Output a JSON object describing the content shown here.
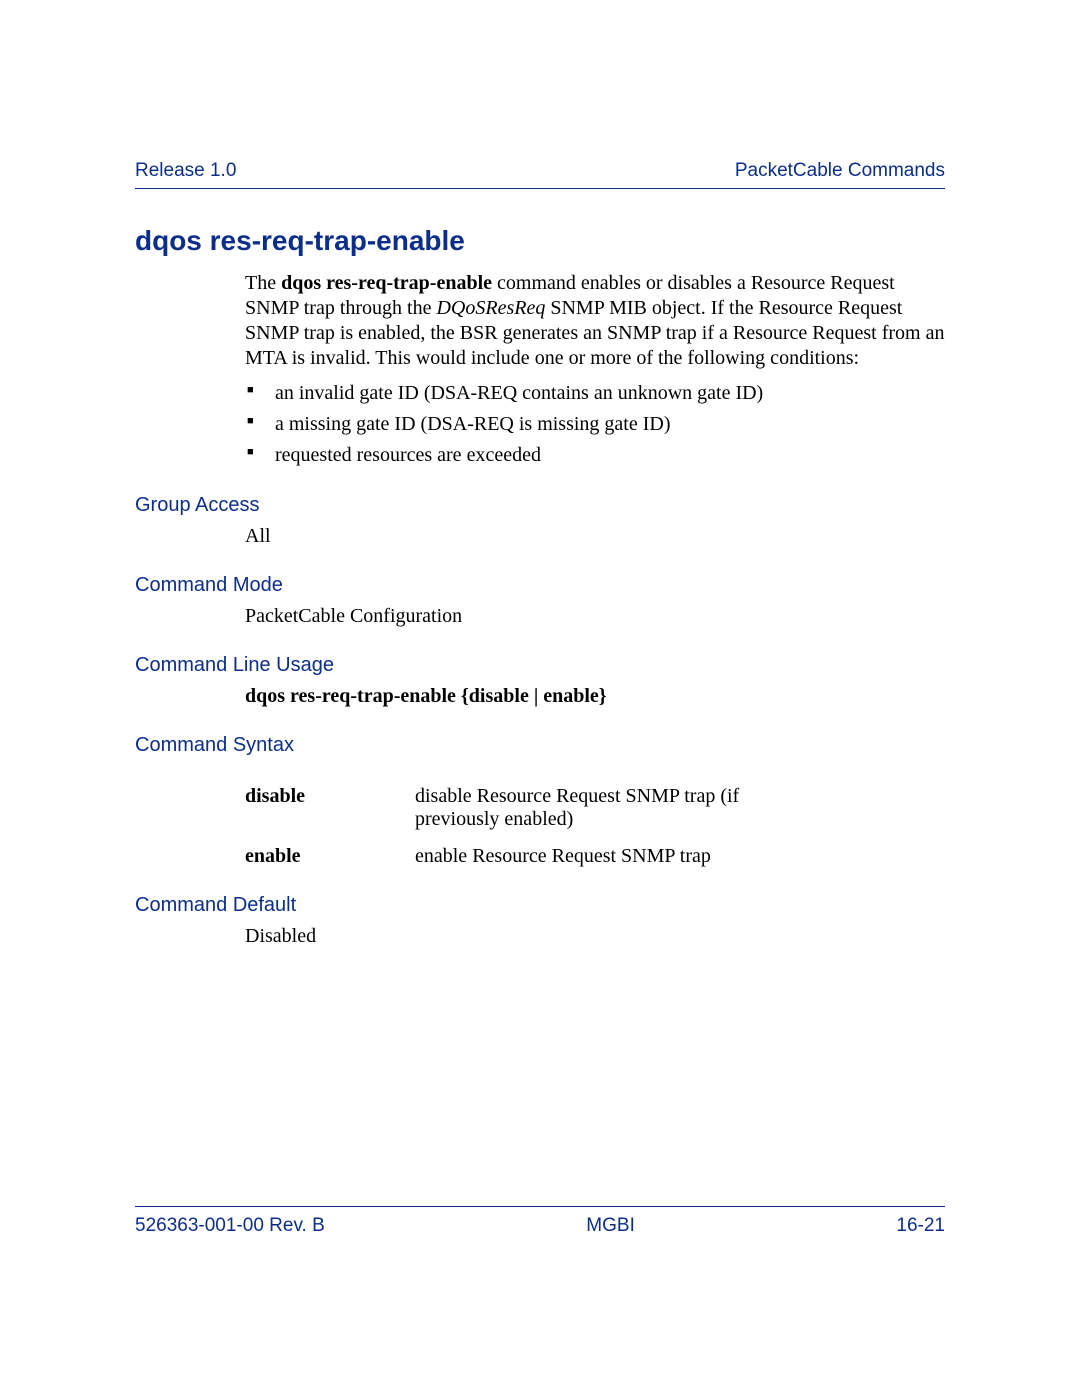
{
  "header": {
    "left": "Release 1.0",
    "right": "PacketCable Commands"
  },
  "title": "dqos res-req-trap-enable",
  "intro": {
    "prefix": "The ",
    "cmd": "dqos res-req-trap-enable",
    "mid1": " command enables or disables a Resource Request SNMP trap through the ",
    "mib": "DQoSResReq",
    "mid2": " SNMP MIB object. If the Resource Request SNMP trap is enabled, the BSR generates an SNMP trap if a Resource Request from an MTA is invalid. This would include one or more of the following conditions:"
  },
  "bullets": [
    "an invalid gate ID (DSA-REQ contains an unknown gate ID)",
    "a missing gate ID (DSA-REQ is missing gate ID)",
    "requested resources are exceeded"
  ],
  "sections": {
    "group_access": {
      "label": "Group Access",
      "value": "All"
    },
    "command_mode": {
      "label": "Command Mode",
      "value": "PacketCable Configuration"
    },
    "command_line_usage": {
      "label": "Command Line Usage",
      "value": "dqos res-req-trap-enable {disable | enable}"
    },
    "command_syntax": {
      "label": "Command Syntax",
      "rows": [
        {
          "key": "disable",
          "desc": "disable Resource Request SNMP trap (if previously enabled)"
        },
        {
          "key": "enable",
          "desc": "enable Resource Request SNMP trap"
        }
      ]
    },
    "command_default": {
      "label": "Command Default",
      "value": "Disabled"
    }
  },
  "footer": {
    "left": "526363-001-00 Rev. B",
    "center": "MGBI",
    "right": "16-21"
  }
}
